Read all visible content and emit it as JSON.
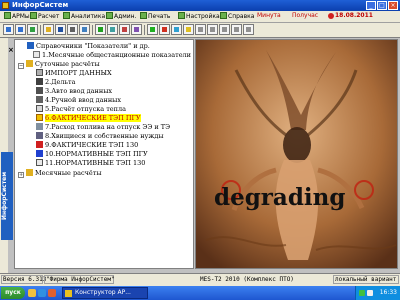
{
  "window": {
    "title": "ИнфорСистем"
  },
  "menu": {
    "items": [
      {
        "label": "АРМы",
        "icon": "arm-icon"
      },
      {
        "label": "Расчет",
        "icon": "calc-icon"
      },
      {
        "label": "Аналитика",
        "icon": "analytics-icon"
      },
      {
        "label": "Админ.",
        "icon": "admin-icon"
      },
      {
        "label": "Печать",
        "icon": "print-icon"
      },
      {
        "label": "Настройка",
        "icon": "settings-icon"
      },
      {
        "label": "Справка",
        "icon": "help-icon"
      }
    ],
    "status_minute": "Минута",
    "status_received": "Получас",
    "date": "18.08.2011"
  },
  "tree": {
    "items": [
      {
        "label": "Справочники \"Показатели\" и др.",
        "icon": "book-icon"
      },
      {
        "label": "1.Месячные общестанционные показатели",
        "icon": "doc-icon"
      },
      {
        "label": "Суточные расчёты",
        "icon": "folder-icon"
      },
      {
        "label": "ИМПОРТ ДАННЫХ",
        "icon": "import-icon"
      },
      {
        "label": "2.Дельта",
        "icon": "delta-icon"
      },
      {
        "label": "3.Авто ввод данных",
        "icon": "auto-icon"
      },
      {
        "label": "4.Ручной ввод данных",
        "icon": "manual-icon"
      },
      {
        "label": "5.Расчёт отпуска тепла",
        "icon": "heat-icon"
      },
      {
        "label": "6.ФАКТИЧЕСКИЕ ТЭП ПГУ",
        "icon": "warning-icon"
      },
      {
        "label": "7.Расход топлива на отпуск ЭЭ и ТЭ",
        "icon": "fuel-icon"
      },
      {
        "label": "8.Хвищиеся и собственные нужды",
        "icon": "needs-icon"
      },
      {
        "label": "9.ФАКТИЧЕСКИЕ ТЭП 130",
        "icon": "check-icon"
      },
      {
        "label": "10.НОРМАТИВНЫЕ ТЭП ПГУ",
        "icon": "star-icon"
      },
      {
        "label": "11.НОРМАТИВНЫЕ ТЭП 130",
        "icon": "list-icon"
      },
      {
        "label": "Месячные расчёты",
        "icon": "folder-icon"
      }
    ]
  },
  "sidebar": {
    "vertical_label": "ИнфорСистем"
  },
  "image_pane": {
    "watermark": "degrading"
  },
  "statusbar": {
    "version": "Версия 6.313",
    "company": "\"Фирма ИнфорСистем\"",
    "center": "MES-T2  2010  (Комплекс ПТО)",
    "mode": "локальный вариант"
  },
  "taskbar": {
    "start_label": "пуск",
    "task_label": "Конструктор АР...",
    "clock": "16:33"
  },
  "colors": {
    "accent_title": "#0b3fae",
    "highlight_bg": "#ffff00",
    "highlight_text": "#c00000",
    "status_red": "#c00000"
  }
}
